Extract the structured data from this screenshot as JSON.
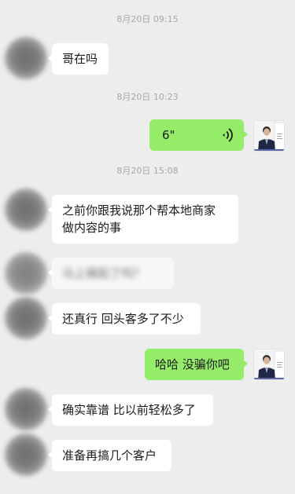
{
  "timestamps": [
    "8月20日 09:15",
    "8月20日 10:23",
    "8月20日 15:08"
  ],
  "messages": {
    "m1": "哥在吗",
    "voice_duration": "6\"",
    "m3_line1": "之前你跟我说那个帮本地商家",
    "m3_line2": "做内容的事",
    "m4_blurred": "马上搞起了吗？",
    "m5": "还真行 回头客多了不少",
    "m6": "哈哈 没骗你吧",
    "m7": "确实靠谱 比以前轻松多了",
    "m8": "准备再搞几个客户"
  },
  "colors": {
    "background": "#ededed",
    "received_bubble": "#ffffff",
    "sent_bubble": "#95ec69",
    "timestamp_text": "#a8a8a8"
  },
  "icons": {
    "voice": "voice-wave-icon",
    "avatar_contact": "blurred-avatar",
    "avatar_self": "profile-photo-avatar"
  }
}
